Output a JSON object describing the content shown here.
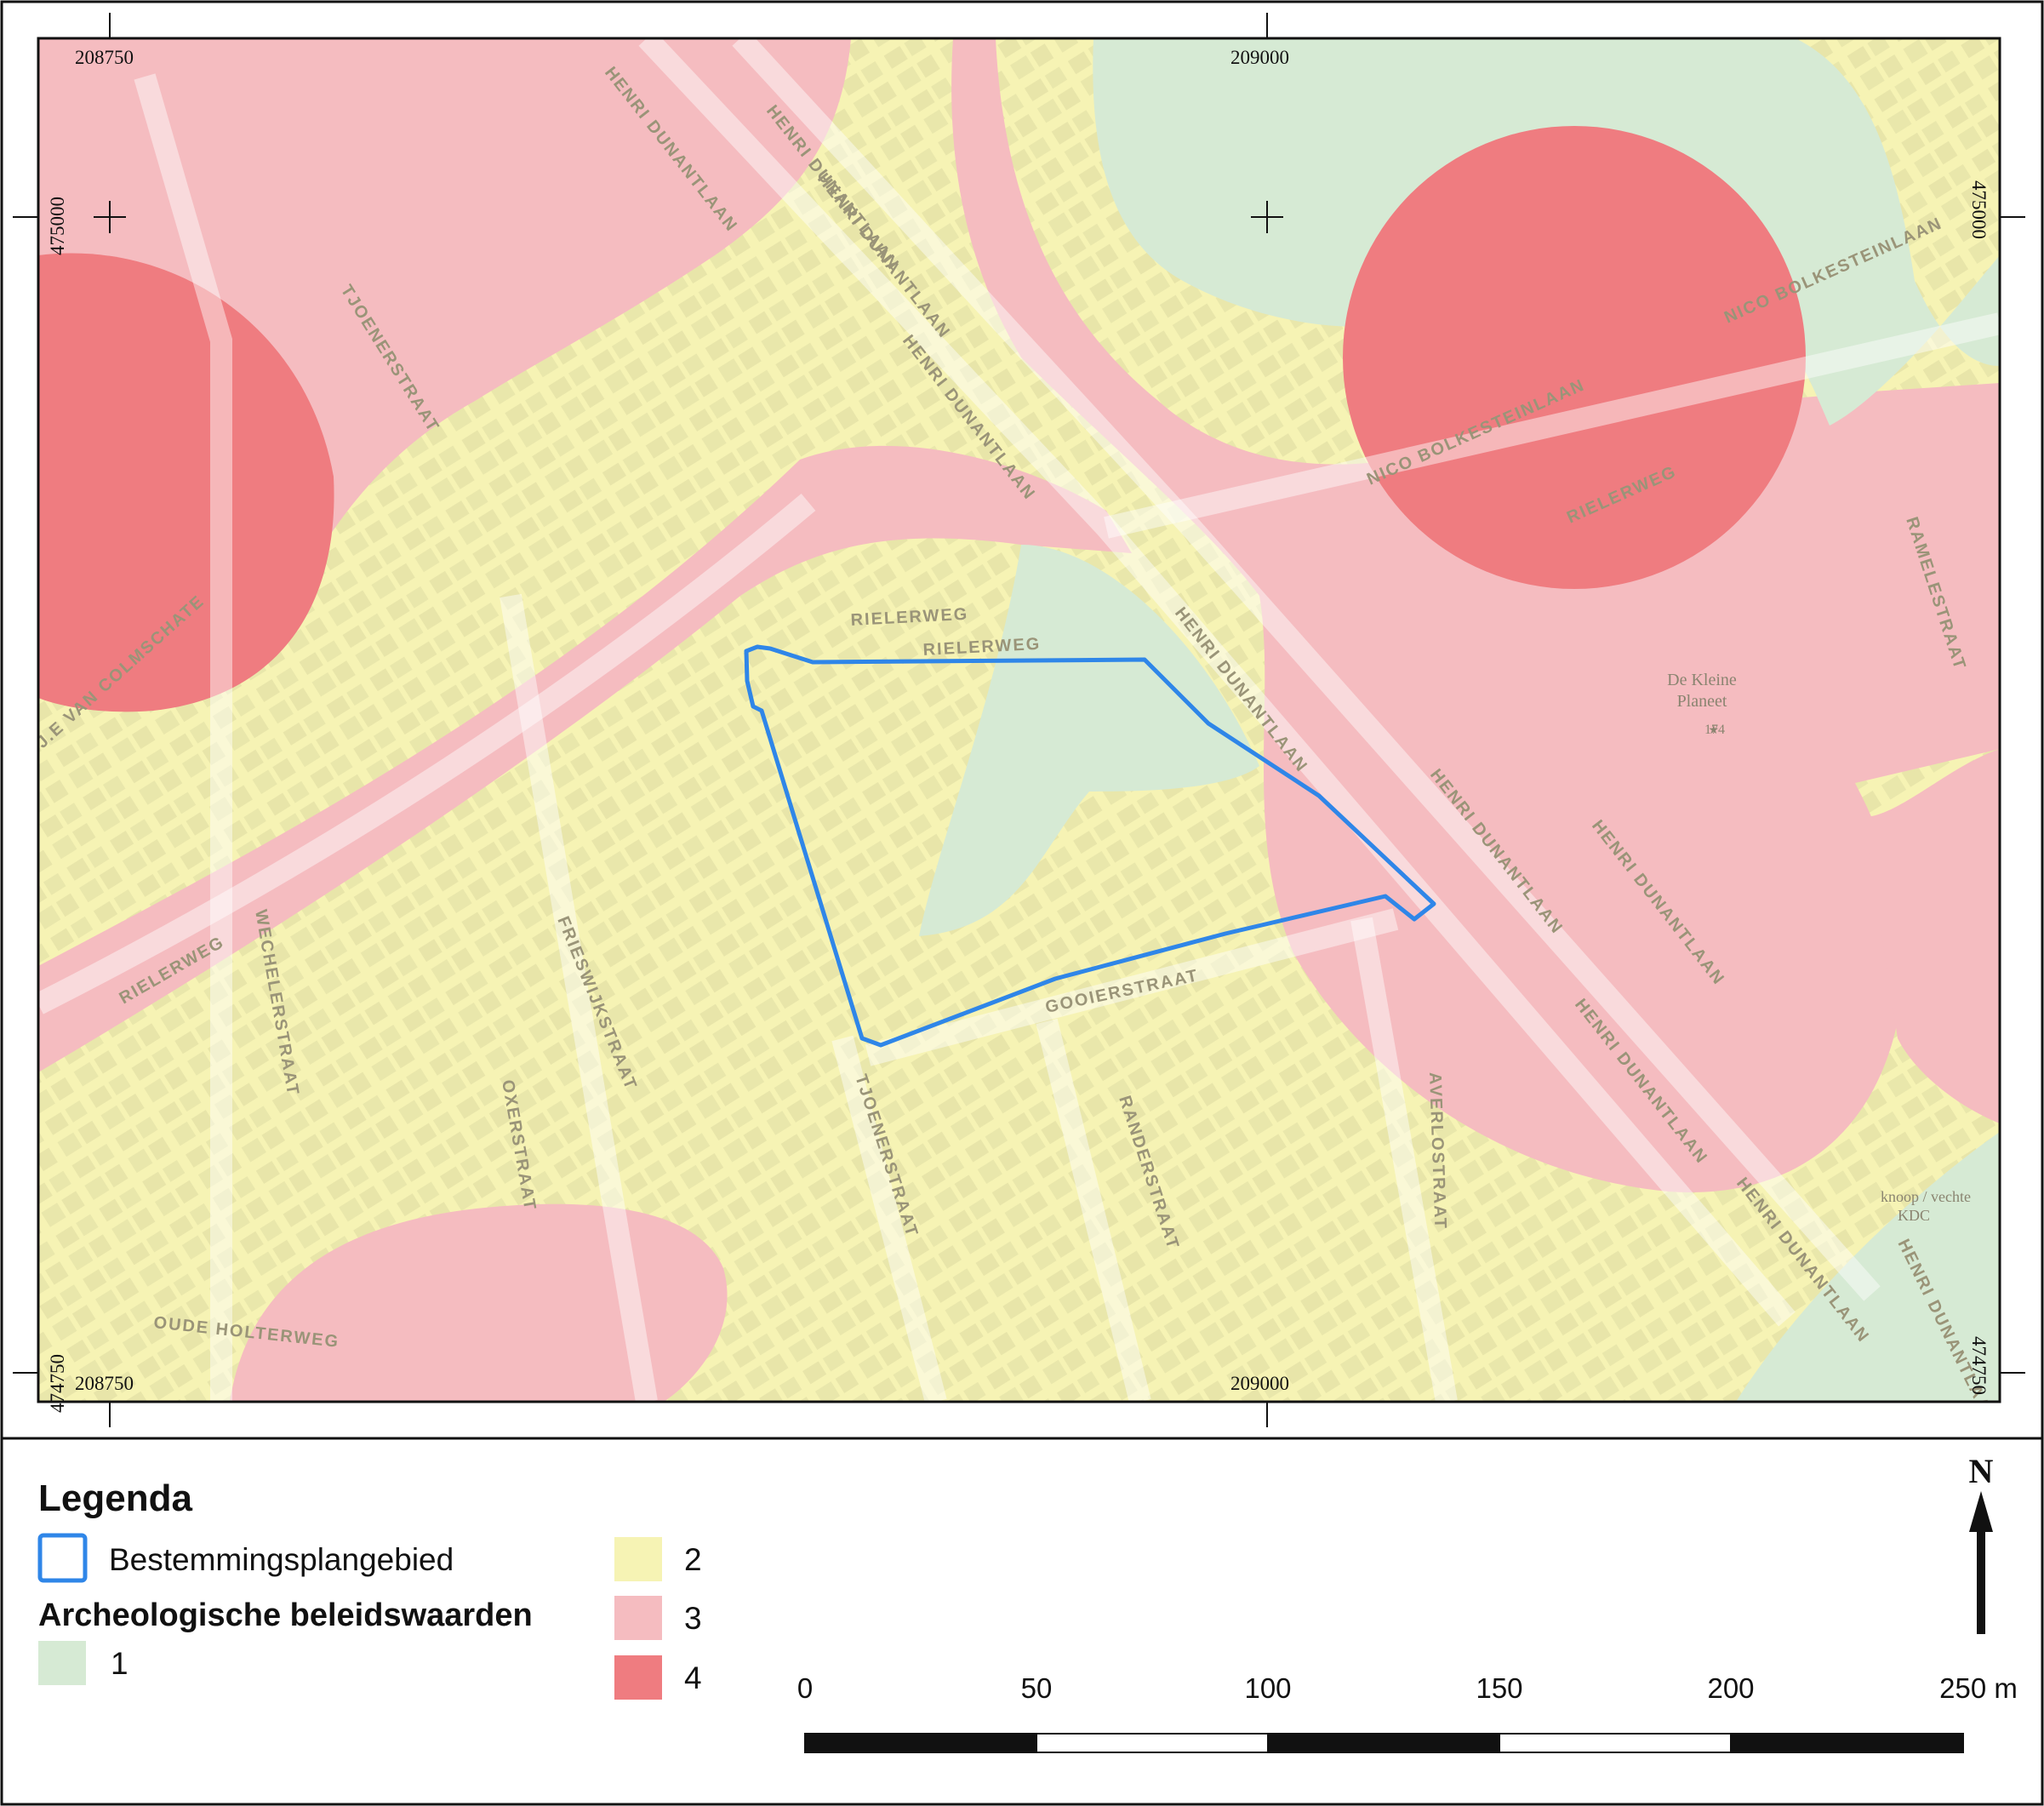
{
  "coordinates": {
    "top_left": "208750",
    "top_mid": "209000",
    "bottom_left": "208750",
    "bottom_mid": "209000",
    "left_top": "475000",
    "right_top": "475000",
    "left_bottom": "474750",
    "right_bottom": "474750"
  },
  "streets": [
    "HENRI DUNANTLAAN",
    "HENRI DUNANTLAAN",
    "HENRI DUNANTLAAN",
    "HENRI DUNANTLAAN",
    "HENRI DUNANTLAAN",
    "HENRI DUNANTLAAN",
    "HENRI DUNANTLAAN",
    "HENRI DUNANTLAAN",
    "HENRI DUNANTLAAN",
    "HENRI DUNANTLAAN",
    "NICO BOLKESTEINLAAN",
    "NICO BOLKESTEINLAAN",
    "RIELERWEG",
    "RIELERWEG",
    "RIELERWEG",
    "RIELERWEG",
    "TJOENERSTRAAT",
    "TJOENERSTRAAT",
    "RAMELESTRAAT",
    "GOOIERSTRAAT",
    "FRIESWIJKSTRAAT",
    "OXERSTRAAT",
    "WECHELERSTRAAT",
    "RANDERSTRAAT",
    "AVERLOSTRAAT",
    "OUDE HOLTERWEG",
    "J.E VAN COLMSCHATE"
  ],
  "pois": {
    "school_name_1": "De Kleine",
    "school_name_2": "Planeet",
    "school_number": "174",
    "knooppunt_1": "knoop / vechte",
    "knooppunt_2": "KDC"
  },
  "legend": {
    "title": "Legenda",
    "boundary_label": "Bestemmingsplangebied",
    "values_title": "Archeologische beleidswaarden",
    "classes": [
      {
        "label": "1",
        "color": "#d6ead4"
      },
      {
        "label": "2",
        "color": "#f6f3b4"
      },
      {
        "label": "3",
        "color": "#f5bcc0"
      },
      {
        "label": "4",
        "color": "#ef7c80"
      }
    ],
    "boundary_color": "#2f86e8"
  },
  "north_arrow": "N",
  "scale_bar": {
    "labels": [
      "0",
      "50",
      "100",
      "150",
      "200",
      "250 m"
    ]
  }
}
